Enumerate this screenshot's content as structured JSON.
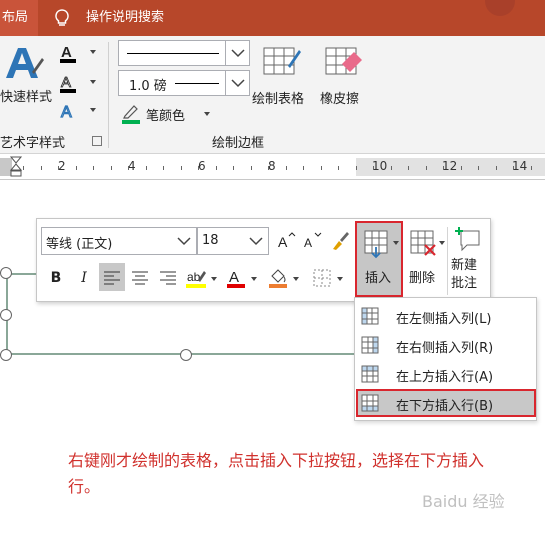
{
  "topbar": {
    "tab_layout": "布局",
    "tell_me": "操作说明搜索"
  },
  "ribbon": {
    "quick_styles": "快速样式",
    "wordart_styles_group": "艺术字样式",
    "line_weight": "1.0 磅",
    "pen_color": "笔颜色",
    "draw_table": "绘制表格",
    "eraser": "橡皮擦",
    "draw_borders_group": "绘制边框",
    "pen_color_value": "#00b050"
  },
  "ruler": {
    "numbers": [
      "2",
      "4",
      "6",
      "8",
      "10",
      "12",
      "14"
    ]
  },
  "mini_toolbar": {
    "font_name": "等线 (正文)",
    "font_size": "18",
    "insert_label": "插入",
    "delete_label": "删除",
    "new_comment_label": "新建批注",
    "bold": "B",
    "italic": "I"
  },
  "insert_menu": {
    "items": [
      "在左侧插入列(L)",
      "在右侧插入列(R)",
      "在上方插入行(A)",
      "在下方插入行(B)"
    ]
  },
  "caption": "右键刚才绘制的表格，点击插入下拉按钮，选择在下方插入行。",
  "watermark": "Baidu 经验",
  "colors": {
    "brand_bar": "#b7472a",
    "highlight_red": "#d9262e",
    "caption_red": "#d0312d"
  }
}
